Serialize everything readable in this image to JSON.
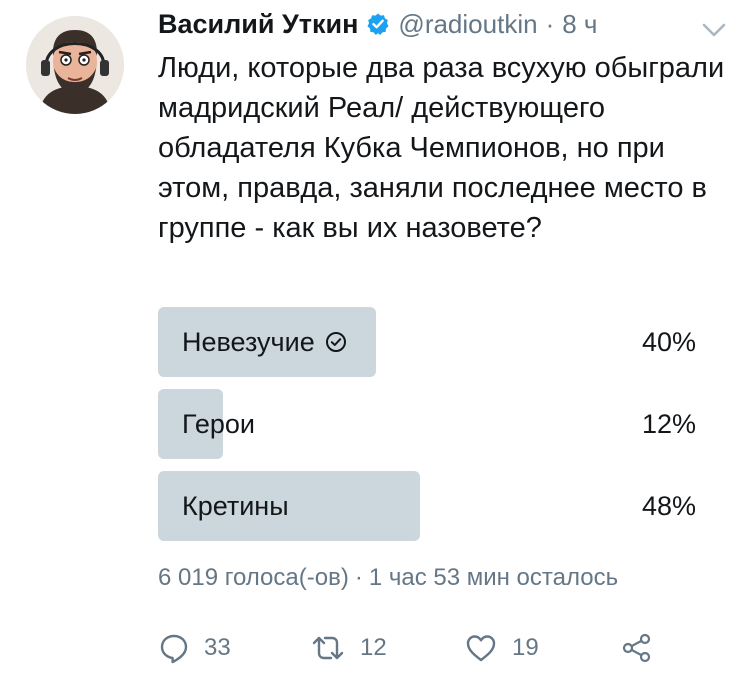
{
  "tweet": {
    "author_name": "Василий Уткин",
    "handle": "@radioutkin",
    "separator": "·",
    "time": "8 ч",
    "text": "Люди, которые два раза всухую обыграли мадридский Реал/ действующего обладателя Кубка Чемпионов, но при этом, правда, заняли последнее место в группе - как вы их назовете?"
  },
  "poll": {
    "options": [
      {
        "label": "Невезучие",
        "percent_text": "40%",
        "percent": 40,
        "voted": true
      },
      {
        "label": "Герои",
        "percent_text": "12%",
        "percent": 12,
        "voted": false
      },
      {
        "label": "Кретины",
        "percent_text": "48%",
        "percent": 48,
        "voted": false
      }
    ],
    "votes_text": "6 019 голоса(-ов)",
    "meta_separator": "·",
    "time_left_text": "1 час 53 мин осталось"
  },
  "actions": {
    "replies": "33",
    "retweets": "12",
    "likes": "19"
  },
  "colors": {
    "poll_fill": "#ccd6dd",
    "secondary_text": "#657786",
    "verified_badge": "#1da1f2"
  }
}
